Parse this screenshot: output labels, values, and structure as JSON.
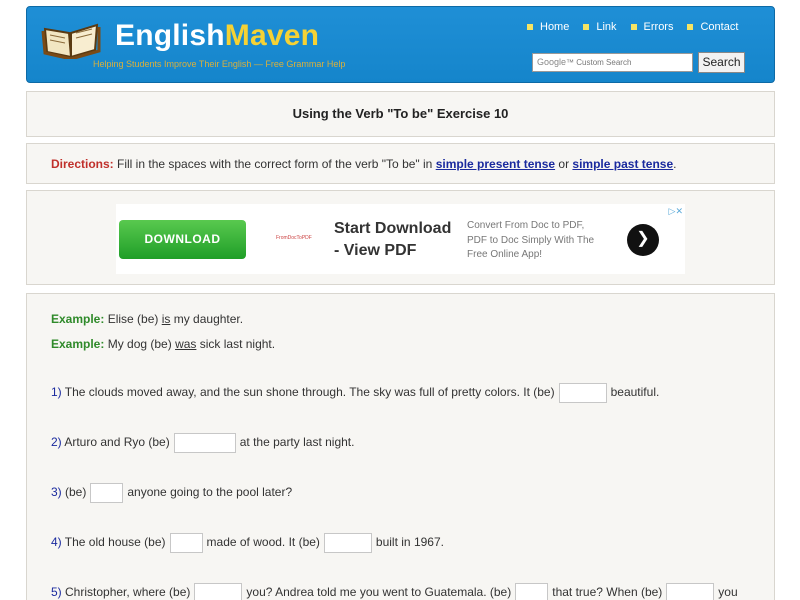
{
  "header": {
    "logo_english": "English",
    "logo_maven": "Maven",
    "tagline": "Helping Students Improve Their English — Free Grammar Help",
    "nav": [
      "Home",
      "Link",
      "Errors",
      "Contact"
    ],
    "search_placeholder": "Custom Search",
    "search_google": "Google",
    "search_button": "Search"
  },
  "title": "Using the Verb \"To be\" Exercise 10",
  "directions": {
    "label": "Directions:",
    "text1": " Fill in the spaces with the correct form of the verb \"To be\" in ",
    "link1": "simple present tense",
    "text2": " or ",
    "link2": "simple past tense",
    "text3": "."
  },
  "ad": {
    "choices": "▷✕",
    "button": "DOWNLOAD",
    "mini": "FromDocToPDF",
    "headline": "Start Download - View PDF",
    "desc": "Convert From Doc to PDF, PDF to Doc Simply With The Free Online App!",
    "arrow": "❯"
  },
  "examples": [
    {
      "label": "Example:",
      "pre": " Elise (be) ",
      "ans": "is",
      "post": " my daughter."
    },
    {
      "label": "Example:",
      "pre": " My dog (be) ",
      "ans": "was",
      "post": " sick last night."
    }
  ],
  "questions": {
    "q1": {
      "num": "1)",
      "a": " The clouds moved away, and the sun shone through. The sky was full of pretty colors. It (be)",
      "b": "beautiful."
    },
    "q2": {
      "num": "2)",
      "a": " Arturo and Ryo (be)",
      "b": "at the party last night."
    },
    "q3": {
      "num": "3)",
      "a": " (be)",
      "b": "anyone going to the pool later?"
    },
    "q4": {
      "num": "4)",
      "a": " The old house (be)",
      "b": "made of wood. It (be)",
      "c": "built in 1967."
    },
    "q5": {
      "num": "5)",
      "a": " Christopher, where (be)",
      "b": "you? Andrea told me you went to Guatemala. (be)",
      "c": "that true? When (be)",
      "d": "you"
    }
  }
}
